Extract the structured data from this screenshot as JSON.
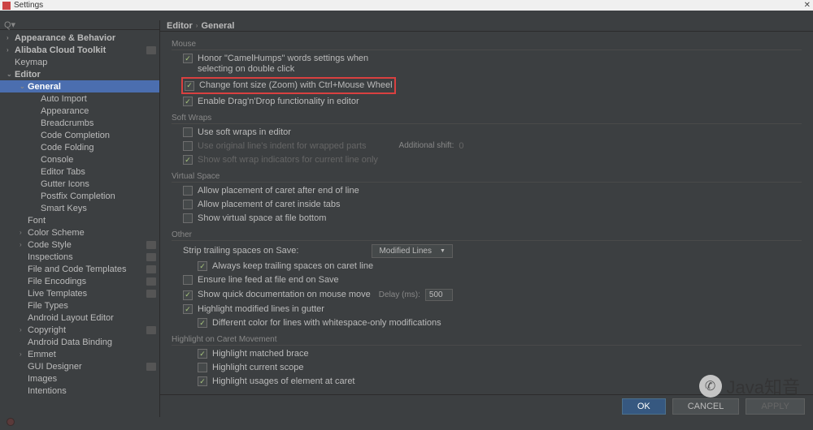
{
  "window": {
    "title": "Settings"
  },
  "breadcrumb": {
    "root": "Editor",
    "leaf": "General"
  },
  "sidebar": {
    "items": [
      {
        "label": "Appearance & Behavior",
        "level": 0,
        "arrow": "›",
        "bold": true
      },
      {
        "label": "Alibaba Cloud Toolkit",
        "level": 0,
        "arrow": "›",
        "bold": true,
        "ext": true
      },
      {
        "label": "Keymap",
        "level": 0,
        "arrow": "",
        "bold": false
      },
      {
        "label": "Editor",
        "level": 0,
        "arrow": "⌄",
        "bold": true
      },
      {
        "label": "General",
        "level": 1,
        "arrow": "⌄",
        "bold": true,
        "selected": true
      },
      {
        "label": "Auto Import",
        "level": 2,
        "arrow": ""
      },
      {
        "label": "Appearance",
        "level": 2,
        "arrow": ""
      },
      {
        "label": "Breadcrumbs",
        "level": 2,
        "arrow": ""
      },
      {
        "label": "Code Completion",
        "level": 2,
        "arrow": ""
      },
      {
        "label": "Code Folding",
        "level": 2,
        "arrow": ""
      },
      {
        "label": "Console",
        "level": 2,
        "arrow": ""
      },
      {
        "label": "Editor Tabs",
        "level": 2,
        "arrow": ""
      },
      {
        "label": "Gutter Icons",
        "level": 2,
        "arrow": ""
      },
      {
        "label": "Postfix Completion",
        "level": 2,
        "arrow": ""
      },
      {
        "label": "Smart Keys",
        "level": 2,
        "arrow": ""
      },
      {
        "label": "Font",
        "level": 1,
        "arrow": ""
      },
      {
        "label": "Color Scheme",
        "level": 1,
        "arrow": "›"
      },
      {
        "label": "Code Style",
        "level": 1,
        "arrow": "›",
        "ext": true
      },
      {
        "label": "Inspections",
        "level": 1,
        "arrow": "",
        "ext": true
      },
      {
        "label": "File and Code Templates",
        "level": 1,
        "arrow": "",
        "ext": true
      },
      {
        "label": "File Encodings",
        "level": 1,
        "arrow": "",
        "ext": true
      },
      {
        "label": "Live Templates",
        "level": 1,
        "arrow": "",
        "ext": true
      },
      {
        "label": "File Types",
        "level": 1,
        "arrow": ""
      },
      {
        "label": "Android Layout Editor",
        "level": 1,
        "arrow": ""
      },
      {
        "label": "Copyright",
        "level": 1,
        "arrow": "›",
        "ext": true
      },
      {
        "label": "Android Data Binding",
        "level": 1,
        "arrow": ""
      },
      {
        "label": "Emmet",
        "level": 1,
        "arrow": "›"
      },
      {
        "label": "GUI Designer",
        "level": 1,
        "arrow": "",
        "ext": true
      },
      {
        "label": "Images",
        "level": 1,
        "arrow": ""
      },
      {
        "label": "Intentions",
        "level": 1,
        "arrow": ""
      }
    ]
  },
  "sections": {
    "mouse": {
      "title": "Mouse",
      "honor": "Honor \"CamelHumps\" words settings when selecting on double click",
      "zoom": "Change font size (Zoom) with Ctrl+Mouse Wheel",
      "dnd": "Enable Drag'n'Drop functionality in editor"
    },
    "softwraps": {
      "title": "Soft Wraps",
      "use": "Use soft wraps in editor",
      "orig": "Use original line's indent for wrapped parts",
      "addshift_label": "Additional shift:",
      "addshift_value": "0",
      "indicators": "Show soft wrap indicators for current line only"
    },
    "vspace": {
      "title": "Virtual Space",
      "afterend": "Allow placement of caret after end of line",
      "insidetabs": "Allow placement of caret inside tabs",
      "bottom": "Show virtual space at file bottom"
    },
    "other": {
      "title": "Other",
      "strip_label": "Strip trailing spaces on Save:",
      "strip_value": "Modified Lines",
      "keepcaret": "Always keep trailing spaces on caret line",
      "linefeed": "Ensure line feed at file end on Save",
      "quickdoc": "Show quick documentation on mouse move",
      "delay_label": "Delay (ms):",
      "delay_value": "500",
      "highlightmod": "Highlight modified lines in gutter",
      "diffcolor": "Different color for lines with whitespace-only modifications"
    },
    "caret": {
      "title": "Highlight on Caret Movement",
      "brace": "Highlight matched brace",
      "scope": "Highlight current scope",
      "usages": "Highlight usages of element at caret"
    }
  },
  "buttons": {
    "ok": "OK",
    "cancel": "CANCEL",
    "apply": "APPLY"
  },
  "watermark": "Java知音"
}
